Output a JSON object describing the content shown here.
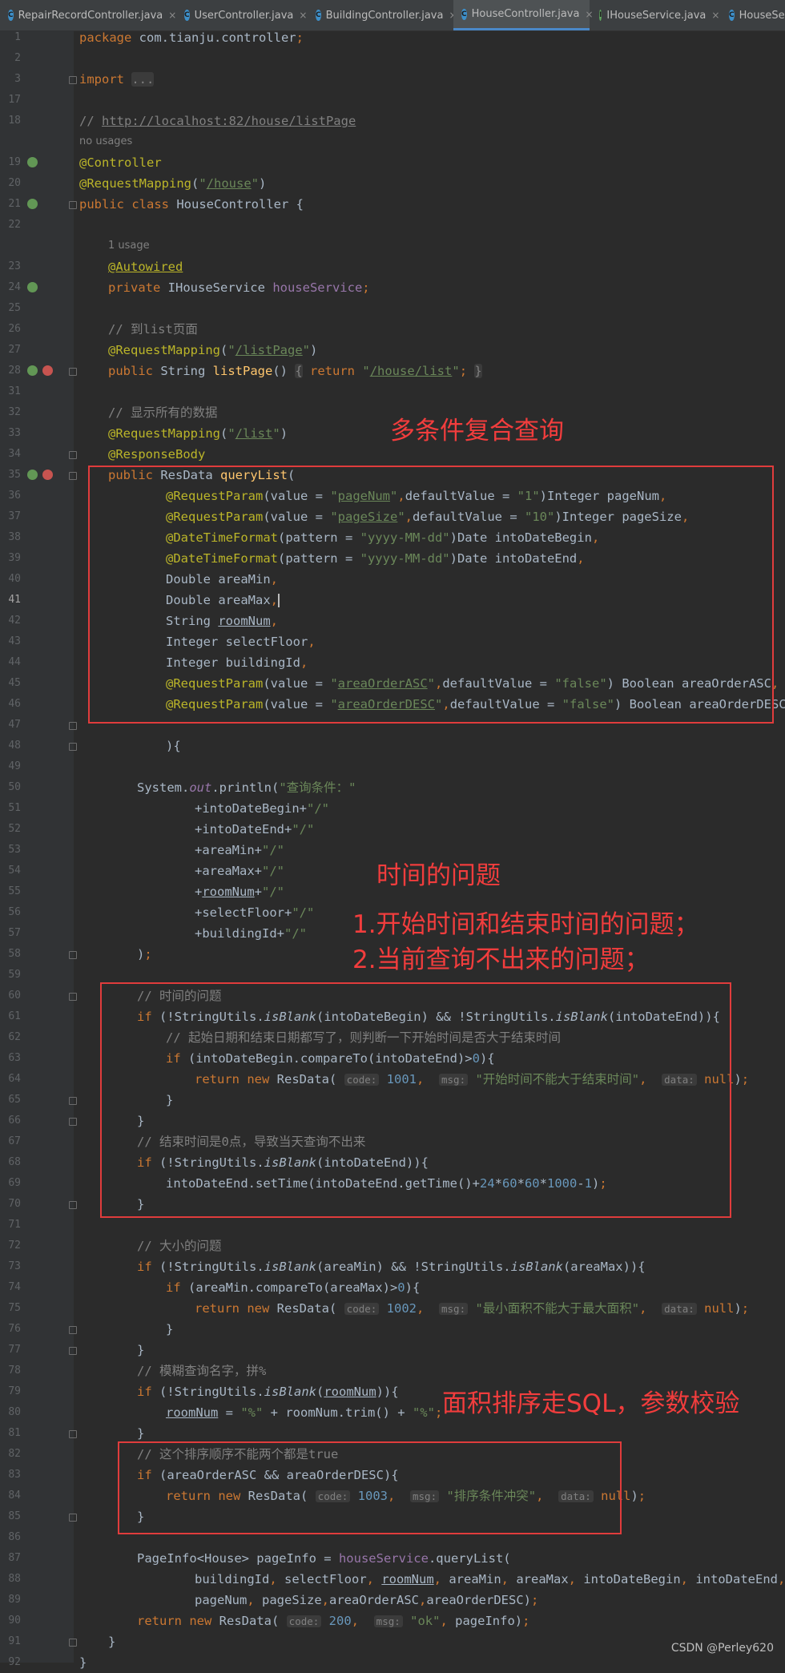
{
  "tabs": [
    {
      "label": "RepairRecordController.java",
      "icon": "class-icon",
      "active": false
    },
    {
      "label": "UserController.java",
      "icon": "class-icon",
      "active": false
    },
    {
      "label": "BuildingController.java",
      "icon": "class-icon",
      "active": false
    },
    {
      "label": "HouseController.java",
      "icon": "class-icon",
      "active": true
    },
    {
      "label": "IHouseService.java",
      "icon": "interface-icon",
      "active": false
    },
    {
      "label": "HouseServ",
      "icon": "class-icon",
      "active": false
    }
  ],
  "editor": {
    "lines": [
      {
        "n": "1",
        "t": "package com.tianju.controller;"
      },
      {
        "n": "2",
        "t": ""
      },
      {
        "n": "3",
        "t": "import ..."
      },
      {
        "n": "17",
        "t": ""
      },
      {
        "n": "18",
        "t": "// http://localhost:82/house/listPage"
      },
      {
        "n": "",
        "t": "no usages"
      },
      {
        "n": "19",
        "t": "@Controller"
      },
      {
        "n": "20",
        "t": "@RequestMapping(\"/house\")"
      },
      {
        "n": "21",
        "t": "public class HouseController {"
      },
      {
        "n": "22",
        "t": ""
      },
      {
        "n": "",
        "t": "1 usage"
      },
      {
        "n": "23",
        "t": "@Autowired"
      },
      {
        "n": "24",
        "t": "private IHouseService houseService;"
      },
      {
        "n": "25",
        "t": ""
      },
      {
        "n": "26",
        "t": "// 到list页面"
      },
      {
        "n": "27",
        "t": "@RequestMapping(\"/listPage\")"
      },
      {
        "n": "28",
        "t": "public String listPage() { return \"/house/list\"; }"
      },
      {
        "n": "31",
        "t": ""
      },
      {
        "n": "32",
        "t": "// 显示所有的数据"
      },
      {
        "n": "33",
        "t": "@RequestMapping(\"/list\")"
      },
      {
        "n": "34",
        "t": "@ResponseBody"
      },
      {
        "n": "35",
        "t": "public ResData queryList("
      },
      {
        "n": "36",
        "t": "@RequestParam(value = \"pageNum\",defaultValue = \"1\")Integer pageNum,"
      },
      {
        "n": "37",
        "t": "@RequestParam(value = \"pageSize\",defaultValue = \"10\")Integer pageSize,"
      },
      {
        "n": "38",
        "t": "@DateTimeFormat(pattern = \"yyyy-MM-dd\")Date intoDateBegin,"
      },
      {
        "n": "39",
        "t": "@DateTimeFormat(pattern = \"yyyy-MM-dd\")Date intoDateEnd,"
      },
      {
        "n": "40",
        "t": "Double areaMin,"
      },
      {
        "n": "41",
        "t": "Double areaMax,"
      },
      {
        "n": "42",
        "t": "String roomNum,"
      },
      {
        "n": "43",
        "t": "Integer selectFloor,"
      },
      {
        "n": "44",
        "t": "Integer buildingId,"
      },
      {
        "n": "45",
        "t": "@RequestParam(value = \"areaOrderASC\",defaultValue = \"false\") Boolean areaOrderASC,"
      },
      {
        "n": "46",
        "t": "@RequestParam(value = \"areaOrderDESC\",defaultValue = \"false\") Boolean areaOrderDESC"
      },
      {
        "n": "47",
        "t": ""
      },
      {
        "n": "48",
        "t": "){"
      },
      {
        "n": "49",
        "t": ""
      },
      {
        "n": "50",
        "t": "System.out.println(\"查询条件：\""
      },
      {
        "n": "51",
        "t": "+intoDateBegin+\"/\""
      },
      {
        "n": "52",
        "t": "+intoDateEnd+\"/\""
      },
      {
        "n": "53",
        "t": "+areaMin+\"/\""
      },
      {
        "n": "54",
        "t": "+areaMax+\"/\""
      },
      {
        "n": "55",
        "t": "+roomNum+\"/\""
      },
      {
        "n": "56",
        "t": "+selectFloor+\"/\""
      },
      {
        "n": "57",
        "t": "+buildingId+\"/\""
      },
      {
        "n": "58",
        "t": ");"
      },
      {
        "n": "59",
        "t": ""
      },
      {
        "n": "60",
        "t": "// 时间的问题"
      },
      {
        "n": "61",
        "t": "if (!StringUtils.isBlank(intoDateBegin) && !StringUtils.isBlank(intoDateEnd)){"
      },
      {
        "n": "62",
        "t": "// 起始日期和结束日期都写了，则判断一下开始时间是否大于结束时间"
      },
      {
        "n": "63",
        "t": "if (intoDateBegin.compareTo(intoDateEnd)>0){"
      },
      {
        "n": "64",
        "t": "return new ResData( code: 1001,  msg: \"开始时间不能大于结束时间\",  data: null);"
      },
      {
        "n": "65",
        "t": "}"
      },
      {
        "n": "66",
        "t": "}"
      },
      {
        "n": "67",
        "t": "// 结束时间是0点，导致当天查询不出来"
      },
      {
        "n": "68",
        "t": "if (!StringUtils.isBlank(intoDateEnd)){"
      },
      {
        "n": "69",
        "t": "intoDateEnd.setTime(intoDateEnd.getTime()+24*60*60*1000-1);"
      },
      {
        "n": "70",
        "t": "}"
      },
      {
        "n": "71",
        "t": ""
      },
      {
        "n": "72",
        "t": "// 大小的问题"
      },
      {
        "n": "73",
        "t": "if (!StringUtils.isBlank(areaMin) && !StringUtils.isBlank(areaMax)){"
      },
      {
        "n": "74",
        "t": "if (areaMin.compareTo(areaMax)>0){"
      },
      {
        "n": "75",
        "t": "return new ResData( code: 1002,  msg: \"最小面积不能大于最大面积\",  data: null);"
      },
      {
        "n": "76",
        "t": "}"
      },
      {
        "n": "77",
        "t": "}"
      },
      {
        "n": "78",
        "t": "// 模糊查询名字，拼%"
      },
      {
        "n": "79",
        "t": "if (!StringUtils.isBlank(roomNum)){"
      },
      {
        "n": "80",
        "t": "roomNum = \"%\" + roomNum.trim() + \"%\";"
      },
      {
        "n": "81",
        "t": "}"
      },
      {
        "n": "82",
        "t": "// 这个排序顺序不能两个都是true"
      },
      {
        "n": "83",
        "t": "if (areaOrderASC && areaOrderDESC){"
      },
      {
        "n": "84",
        "t": "return new ResData( code: 1003,  msg: \"排序条件冲突\",  data: null);"
      },
      {
        "n": "85",
        "t": "}"
      },
      {
        "n": "86",
        "t": ""
      },
      {
        "n": "87",
        "t": "PageInfo<House> pageInfo = houseService.queryList("
      },
      {
        "n": "88",
        "t": "buildingId, selectFloor, roomNum, areaMin, areaMax, intoDateBegin, intoDateEnd,"
      },
      {
        "n": "89",
        "t": "pageNum, pageSize,areaOrderASC,areaOrderDESC);"
      },
      {
        "n": "90",
        "t": "return new ResData( code: 200,  msg: \"ok\", pageInfo);"
      },
      {
        "n": "91",
        "t": "}"
      },
      {
        "n": "92",
        "t": "}"
      }
    ]
  },
  "annotations": {
    "multi_condition": "多条件复合查询",
    "time_problem": "时间的问题",
    "time_issue_1": "1.开始时间和结束时间的问题；",
    "time_issue_2": "2.当前查询不出来的问题；",
    "area_sort": "面积排序走SQL，参数校验"
  },
  "watermark": "CSDN @Perley620",
  "colors": {
    "editor_bg": "#2b2b2b",
    "keyword": "#cc7832",
    "annotation": "#bbb529",
    "string": "#6a8759",
    "number": "#6897bb",
    "comment": "#808080",
    "method": "#ffc66d",
    "field": "#9876aa",
    "markup_red": "#e03c3c"
  }
}
